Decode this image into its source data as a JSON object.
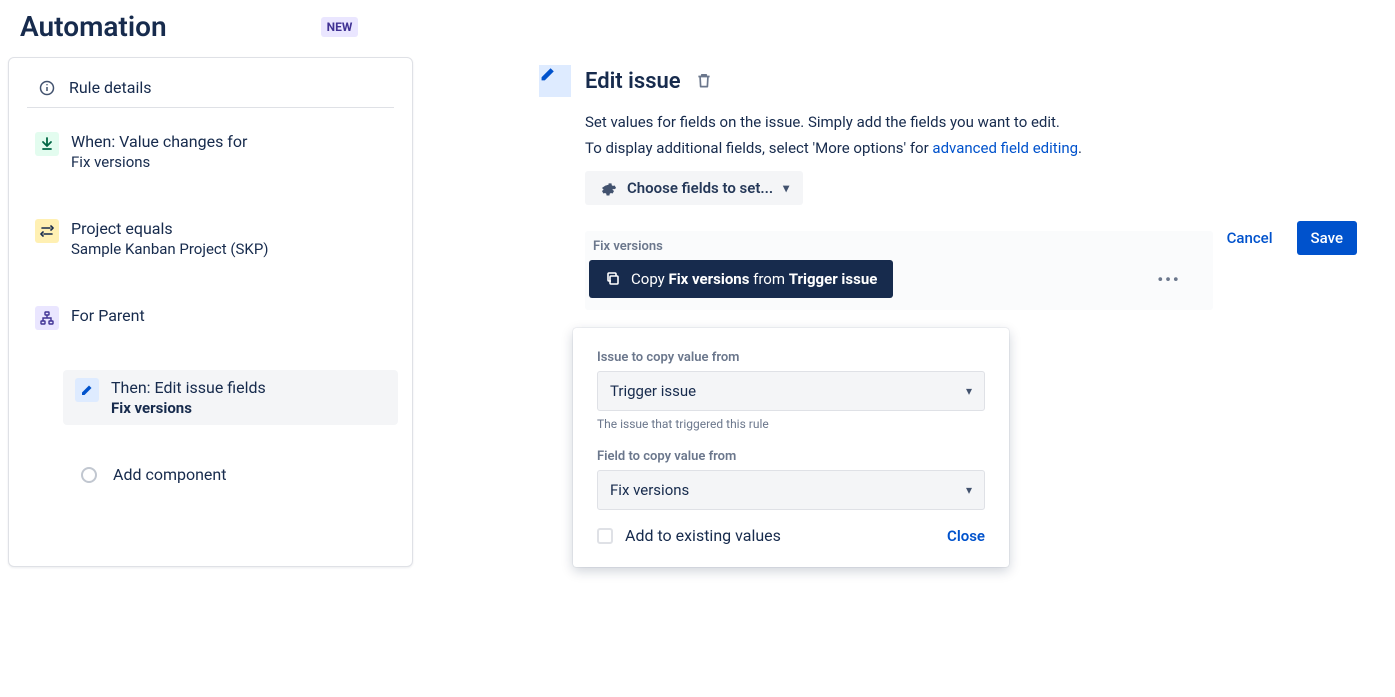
{
  "header": {
    "title": "Automation",
    "badge": "NEW"
  },
  "left": {
    "ruleDetails": "Rule details",
    "trigger": {
      "title": "When: Value changes for",
      "sub": "Fix versions"
    },
    "condition": {
      "title": "Project equals",
      "sub": "Sample Kanban Project (SKP)"
    },
    "branch": {
      "title": "For Parent"
    },
    "action": {
      "title": "Then: Edit issue fields",
      "sub": "Fix versions"
    },
    "addComponent": "Add component"
  },
  "right": {
    "title": "Edit issue",
    "desc1": "Set values for fields on the issue. Simply add the fields you want to edit.",
    "desc2_pre": "To display additional fields, select 'More options' for ",
    "desc2_link": "advanced field editing",
    "desc2_post": ".",
    "chooseFields": "Choose fields to set...",
    "fieldLabel": "Fix versions",
    "copy": {
      "pre": "Copy ",
      "bold": "Fix versions",
      "mid": " from ",
      "bold2": "Trigger issue"
    },
    "popover": {
      "label1": "Issue to copy value from",
      "select1": "Trigger issue",
      "hint1": "The issue that triggered this rule",
      "label2": "Field to copy value from",
      "select2": "Fix versions",
      "checkboxLabel": "Add to existing values",
      "close": "Close"
    },
    "cancel": "Cancel",
    "save": "Save"
  }
}
